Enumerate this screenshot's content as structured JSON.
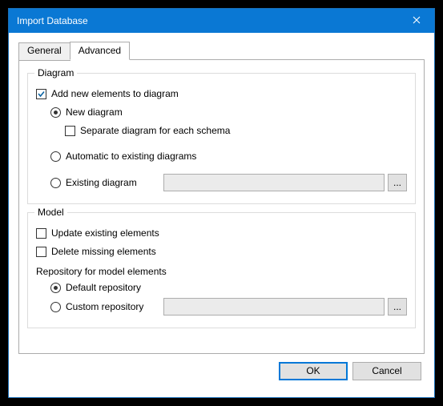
{
  "window": {
    "title": "Import Database"
  },
  "tabs": {
    "general": "General",
    "advanced": "Advanced"
  },
  "diagram": {
    "group_title": "Diagram",
    "add_new_elements": "Add new elements to diagram",
    "new_diagram": "New diagram",
    "separate_per_schema": "Separate diagram for each schema",
    "automatic_existing": "Automatic to existing diagrams",
    "existing_diagram": "Existing diagram",
    "existing_diagram_value": "",
    "browse_label": "..."
  },
  "model": {
    "group_title": "Model",
    "update_existing": "Update existing elements",
    "delete_missing": "Delete missing elements",
    "repo_heading": "Repository for model elements",
    "default_repo": "Default repository",
    "custom_repo": "Custom repository",
    "custom_repo_value": "",
    "browse_label": "..."
  },
  "buttons": {
    "ok": "OK",
    "cancel": "Cancel"
  }
}
